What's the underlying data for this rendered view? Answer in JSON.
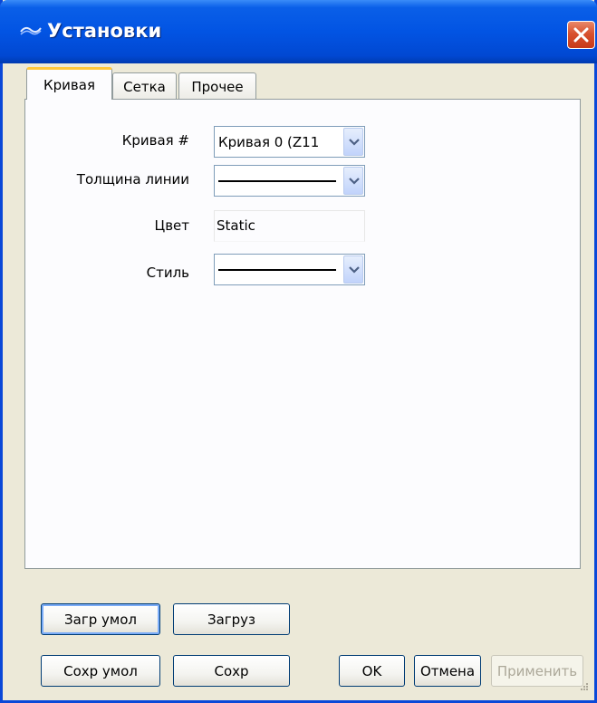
{
  "window": {
    "title": "Установки"
  },
  "tabs": [
    {
      "label": "Кривая",
      "active": true
    },
    {
      "label": "Сетка",
      "active": false
    },
    {
      "label": "Прочее",
      "active": false
    }
  ],
  "form": {
    "curve_label": "Кривая #",
    "curve_value": "Кривая 0 (Z11",
    "thickness_label": "Толщина линии",
    "color_label": "Цвет",
    "color_value": "Static",
    "style_label": "Стиль"
  },
  "buttons": {
    "load_default": "Загр умол",
    "load": "Загруз",
    "save_default": "Сохр умол",
    "save": "Сохр",
    "ok": "OK",
    "cancel": "Отмена",
    "apply": "Применить"
  },
  "colors": {
    "titlebar": "#0254e3",
    "dialog_bg": "#ece9d8",
    "active_tab_accent": "#ffc83c",
    "close": "#d8512f"
  },
  "icons": [
    "app-icon",
    "close-icon",
    "chevron-down-icon",
    "resize-grip-icon"
  ]
}
